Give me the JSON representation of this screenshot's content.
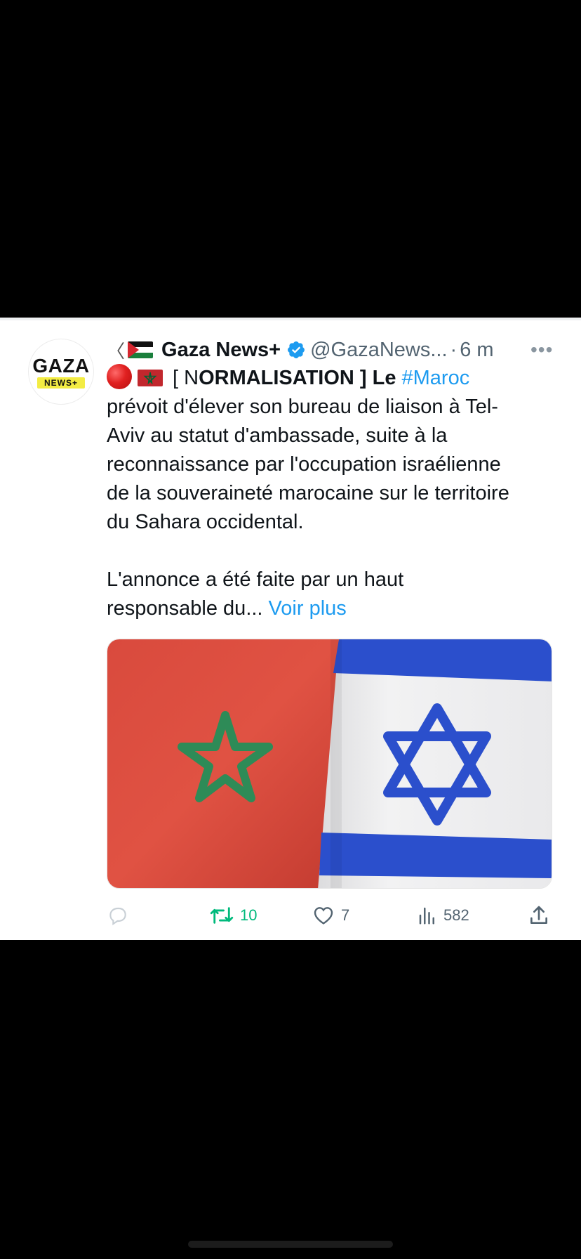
{
  "tweet": {
    "avatar": {
      "line1": "GAZA",
      "line2": "NEWS+"
    },
    "author": {
      "map_glyph": "〈",
      "flag_icon": "palestine-flag",
      "name": "Gaza News+",
      "verified_icon": "verified-badge-icon",
      "handle": "@GazaNews...",
      "separator": "·",
      "time": "6 m"
    },
    "more_label": "•••",
    "text": {
      "line1_prefix": "[ N",
      "line1_bold": "ORMALISATION ] Le",
      "line1_hashtag": "#Maroc",
      "line2": "prévoit d'élever son bureau de liaison à Tel-",
      "line3": "Aviv au statut d'ambassade, suite à la",
      "line4": "reconnaissance par l'occupation israélienne",
      "line5": "de la souveraineté marocaine sur le territoire",
      "line6": "du Sahara occidental.",
      "line7": "L'annonce a été faite par un haut",
      "line8_text": "responsable du...",
      "line8_link": "Voir plus"
    },
    "media_description_icons": [
      "morocco-flag",
      "israel-flag"
    ],
    "actions": {
      "reply_count": "",
      "retweet_count": "10",
      "like_count": "7",
      "views_count": "582"
    },
    "colors": {
      "link": "#1d9bf0",
      "retweet_active": "#00ba7c",
      "muted": "#536471"
    }
  }
}
